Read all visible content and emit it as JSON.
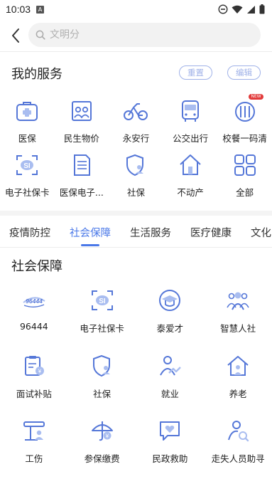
{
  "status": {
    "time": "10:03",
    "notif_glyph": "A"
  },
  "search": {
    "placeholder": "文明分"
  },
  "services": {
    "title": "我的服务",
    "reset_label": "重置",
    "edit_label": "编辑",
    "row1": [
      {
        "label": "医保",
        "icon": "medical-kit-icon"
      },
      {
        "label": "民生物价",
        "icon": "price-board-icon"
      },
      {
        "label": "永安行",
        "icon": "bicycle-icon"
      },
      {
        "label": "公交出行",
        "icon": "bus-icon"
      },
      {
        "label": "校餐一码清",
        "icon": "school-meal-icon",
        "badge": "NEW"
      }
    ],
    "row2": [
      {
        "label": "电子社保卡",
        "icon": "social-card-scan-icon"
      },
      {
        "label": "医保电子...",
        "icon": "document-icon"
      },
      {
        "label": "社保",
        "icon": "shield-person-icon"
      },
      {
        "label": "不动产",
        "icon": "house-icon"
      },
      {
        "label": "全部",
        "icon": "grid-all-icon"
      }
    ]
  },
  "tabs": [
    {
      "label": "疫情防控",
      "active": false
    },
    {
      "label": "社会保障",
      "active": true
    },
    {
      "label": "生活服务",
      "active": false
    },
    {
      "label": "医疗健康",
      "active": false
    },
    {
      "label": "文化",
      "active": false
    }
  ],
  "section": {
    "title": "社会保障",
    "rows": [
      [
        {
          "label": "96444",
          "icon": "hotline-logo-icon"
        },
        {
          "label": "电子社保卡",
          "icon": "social-card-scan-icon"
        },
        {
          "label": "泰爱才",
          "icon": "graduate-cap-icon"
        },
        {
          "label": "智慧人社",
          "icon": "people-group-icon"
        }
      ],
      [
        {
          "label": "面试补贴",
          "icon": "clipboard-money-icon"
        },
        {
          "label": "社保",
          "icon": "shield-person-icon"
        },
        {
          "label": "就业",
          "icon": "person-chart-icon"
        },
        {
          "label": "养老",
          "icon": "home-elder-icon"
        }
      ],
      [
        {
          "label": "工伤",
          "icon": "work-injury-icon"
        },
        {
          "label": "参保缴费",
          "icon": "umbrella-money-icon"
        },
        {
          "label": "民政救助",
          "icon": "heart-message-icon"
        },
        {
          "label": "走失人员助寻",
          "icon": "person-search-icon"
        }
      ]
    ]
  },
  "colors": {
    "accent": "#4a78e8",
    "icon_stroke": "#5577d8",
    "pill": "#9fb1e8",
    "badge": "#e23b3b"
  }
}
